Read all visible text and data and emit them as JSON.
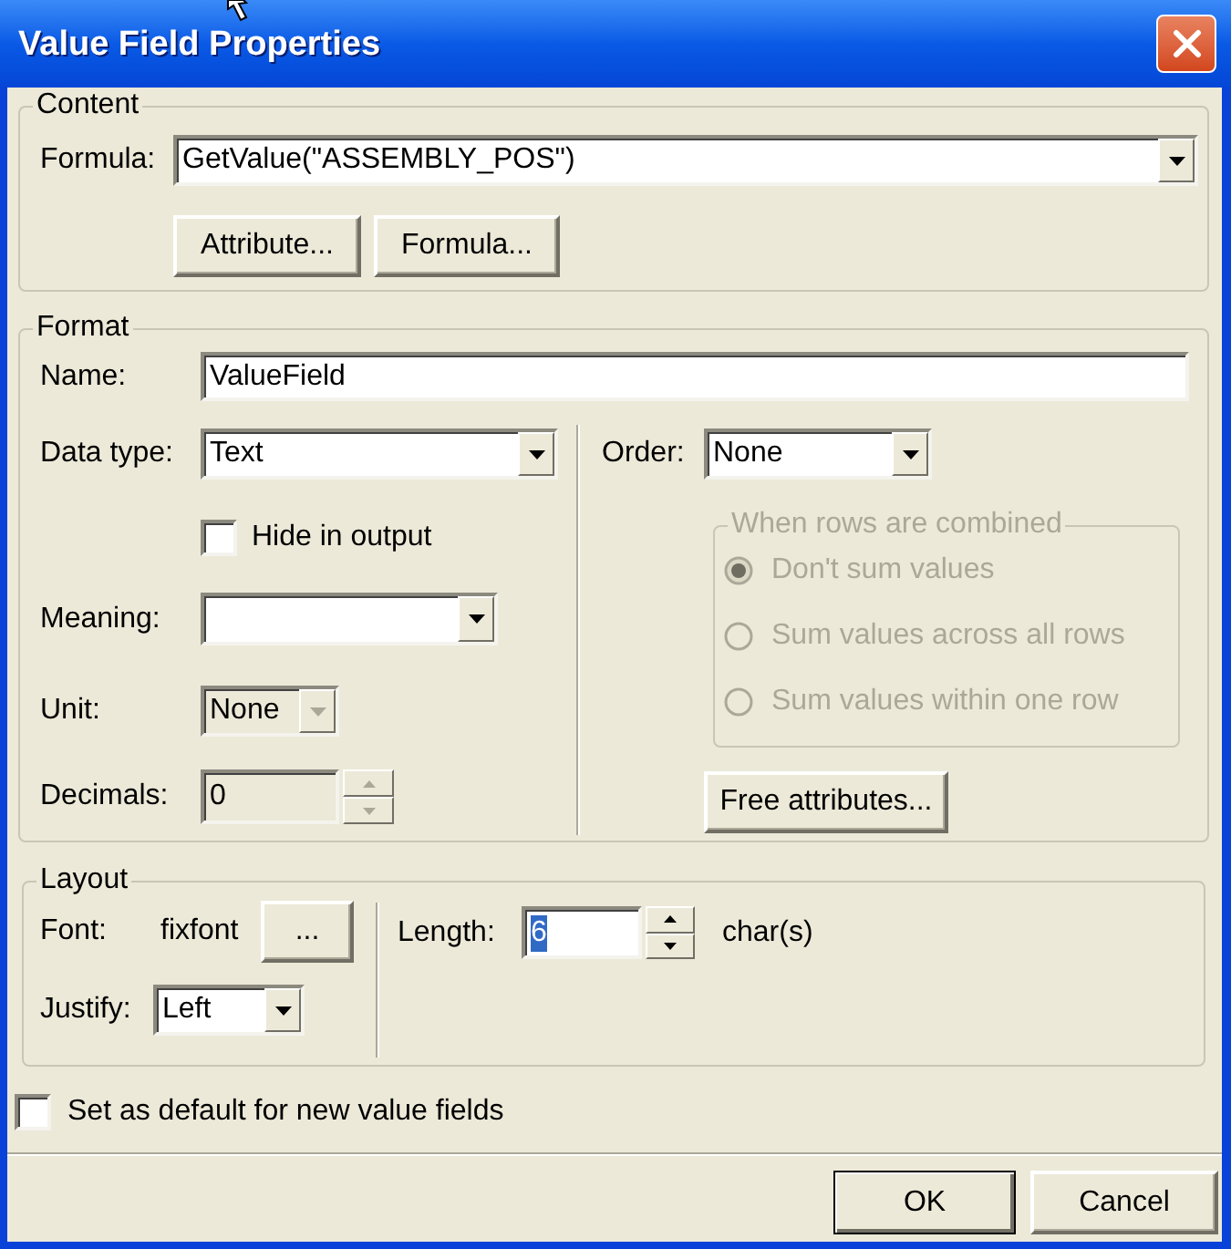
{
  "window": {
    "title": "Value Field Properties"
  },
  "content": {
    "legend": "Content",
    "formula": {
      "label": "Formula:",
      "value": "GetValue(\"ASSEMBLY_POS\")"
    },
    "buttons": [
      "Attribute...",
      "Formula..."
    ]
  },
  "format": {
    "legend": "Format",
    "name": {
      "label": "Name:",
      "value": "ValueField"
    },
    "data_type": {
      "label": "Data type:",
      "value": "Text"
    },
    "hide_in_output": {
      "label": "Hide in output",
      "checked": false
    },
    "meaning": {
      "label": "Meaning:"
    },
    "unit": {
      "label": "Unit:",
      "value": "None",
      "disabled": true
    },
    "decimals": {
      "label": "Decimals:",
      "value": "0",
      "disabled": true
    },
    "order": {
      "label": "Order:",
      "value": "None"
    },
    "combine_group": {
      "legend": "When rows are combined",
      "disabled": true,
      "options": [
        {
          "label": "Don't sum values",
          "selected": true
        },
        {
          "label": "Sum values across all rows",
          "selected": false
        },
        {
          "label": "Sum values within one row",
          "selected": false
        }
      ]
    },
    "free_attributes_button": "Free attributes..."
  },
  "layout": {
    "legend": "Layout",
    "font": {
      "label": "Font:",
      "value": "fixfont",
      "button": "..."
    },
    "justify": {
      "label": "Justify:",
      "value": "Left"
    },
    "length": {
      "label": "Length:",
      "value": "6",
      "selected": true,
      "unit": "char(s)"
    }
  },
  "set_default": {
    "label": "Set as default for new value fields",
    "checked": false
  },
  "buttons": [
    {
      "label": "OK",
      "default": true
    },
    {
      "label": "Cancel",
      "default": false
    }
  ]
}
